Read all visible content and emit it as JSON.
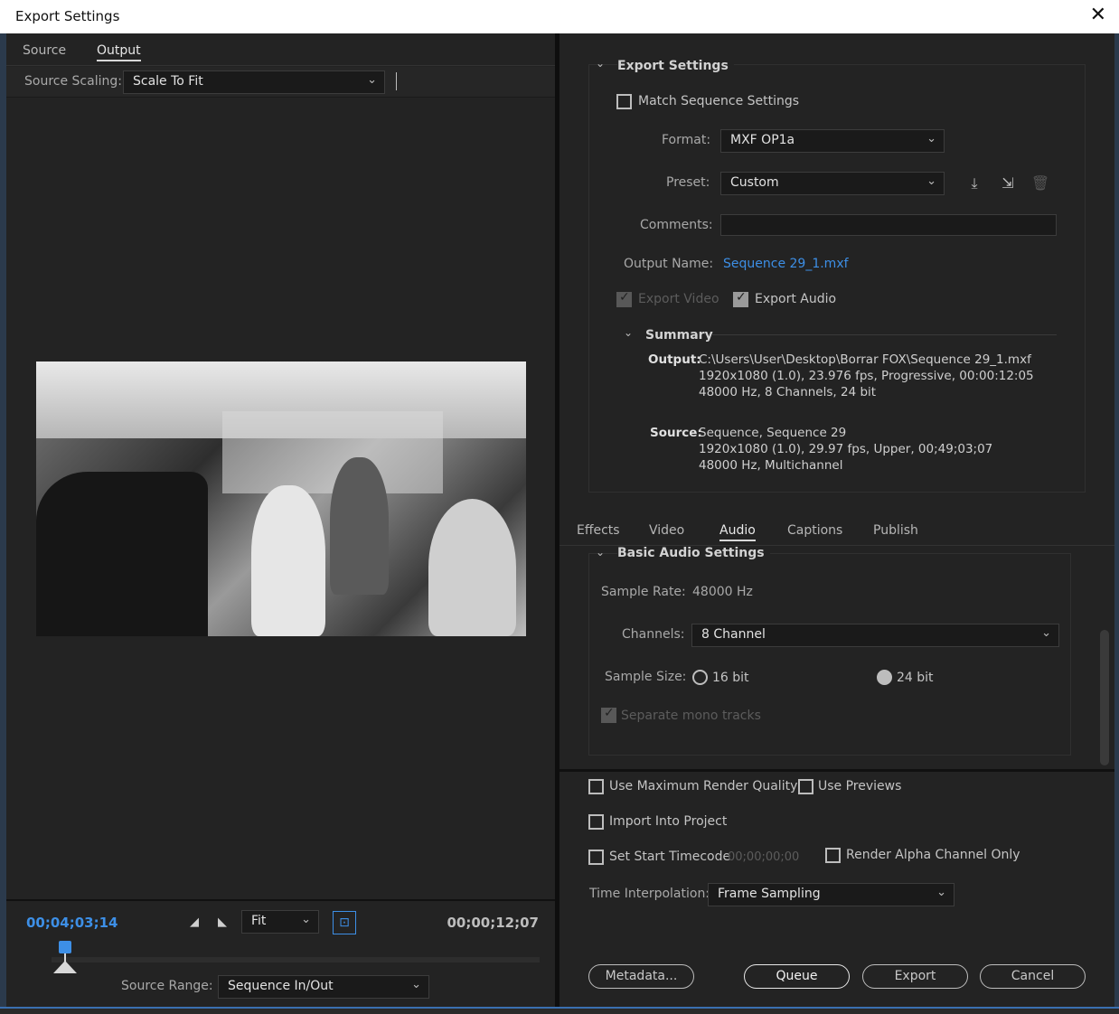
{
  "window": {
    "title": "Export Settings",
    "close_glyph": "✕"
  },
  "left": {
    "tabs": [
      {
        "label": "Source"
      },
      {
        "label": "Output"
      }
    ],
    "source_scaling": {
      "label": "Source Scaling:",
      "value": "Scale To Fit"
    },
    "timeline": {
      "current_timecode": "00;04;03;14",
      "duration_timecode": "00;00;12;07",
      "zoom": {
        "value": "Fit"
      },
      "source_range": {
        "label": "Source Range:",
        "value": "Sequence In/Out"
      }
    }
  },
  "export_settings": {
    "title": "Export Settings",
    "match_sequence": {
      "label": "Match Sequence Settings",
      "checked": false
    },
    "format": {
      "label": "Format:",
      "value": "MXF OP1a"
    },
    "preset": {
      "label": "Preset:",
      "value": "Custom"
    },
    "comments": {
      "label": "Comments:",
      "value": ""
    },
    "output_name": {
      "label": "Output Name:",
      "value": "Sequence 29_1.mxf"
    },
    "export_video": {
      "label": "Export Video",
      "checked": true,
      "disabled": true
    },
    "export_audio": {
      "label": "Export Audio",
      "checked": true
    },
    "summary": {
      "title": "Summary",
      "output_label": "Output:",
      "output_lines": [
        "C:\\Users\\User\\Desktop\\Borrar FOX\\Sequence 29_1.mxf",
        "1920x1080 (1.0), 23.976 fps, Progressive, 00:00:12:05",
        "48000 Hz, 8 Channels, 24 bit"
      ],
      "source_label": "Source:",
      "source_lines": [
        "Sequence, Sequence 29",
        "1920x1080 (1.0), 29.97 fps, Upper, 00;49;03;07",
        "48000 Hz, Multichannel"
      ]
    }
  },
  "settings_tabs": [
    {
      "label": "Effects"
    },
    {
      "label": "Video"
    },
    {
      "label": "Audio",
      "active": true
    },
    {
      "label": "Captions"
    },
    {
      "label": "Publish"
    }
  ],
  "audio": {
    "section_title": "Basic Audio Settings",
    "sample_rate": {
      "label": "Sample Rate:",
      "value": "48000 Hz"
    },
    "channels": {
      "label": "Channels:",
      "value": "8 Channel"
    },
    "sample_size": {
      "label": "Sample Size:",
      "options": [
        {
          "label": "16 bit",
          "selected": false
        },
        {
          "label": "24 bit",
          "selected": true
        }
      ]
    },
    "separate_mono": {
      "label": "Separate mono tracks",
      "checked": true,
      "disabled": true
    }
  },
  "options": {
    "max_render_quality": {
      "label": "Use Maximum Render Quality",
      "checked": false
    },
    "use_previews": {
      "label": "Use Previews",
      "checked": false
    },
    "import_into_project": {
      "label": "Import Into Project",
      "checked": false
    },
    "set_start_timecode": {
      "label": "Set Start Timecode",
      "value": "00;00;00;00",
      "checked": false
    },
    "render_alpha": {
      "label": "Render Alpha Channel Only",
      "checked": false
    },
    "time_interpolation": {
      "label": "Time Interpolation:",
      "value": "Frame Sampling"
    }
  },
  "buttons": {
    "metadata": "Metadata...",
    "queue": "Queue",
    "export": "Export",
    "cancel": "Cancel"
  },
  "colors": {
    "accent": "#3d8fe6",
    "panel": "#232323",
    "link": "#3d8fe6"
  },
  "icons": {
    "save_preset": "download-icon",
    "import_preset": "import-preset-icon",
    "delete_preset": "trash-icon",
    "set_in": "mark-in-icon",
    "set_out": "mark-out-icon",
    "aspect": "aspect-ratio-icon"
  }
}
